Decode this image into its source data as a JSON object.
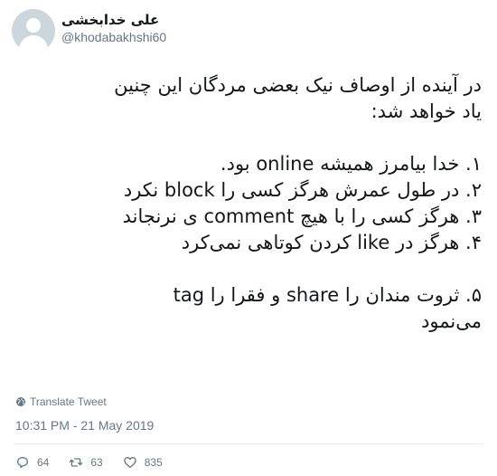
{
  "author": {
    "display_name": "علی خدابخشی",
    "handle": "@khodabakhshi60"
  },
  "tweet": {
    "lines": [
      "در آینده از اوصاف نیک بعضی مردگان این چنین",
      "یاد خواهد شد:",
      "",
      "۱. خدا بیامرز همیشه online بود.",
      "۲. در طول عمرش هرگز کسی را block نکرد",
      "۳. هرگز کسی را با هیچ comment ی نرنجاند",
      "۴. هرگز در like کردن کوتاهی نمی‌کرد",
      "",
      "۵. ثروت مندان را share و فقرا را tag",
      "می‌نمود"
    ]
  },
  "translate_label": "Translate Tweet",
  "timestamp": "10:31 PM - 21 May 2019",
  "actions": {
    "replies": "64",
    "retweets": "63",
    "likes": "835"
  },
  "icons": {
    "translate": "globe-icon",
    "reply": "reply-icon",
    "retweet": "retweet-icon",
    "like": "heart-icon"
  },
  "colors": {
    "secondary_text": "#657786",
    "divider": "#e6ecf0",
    "avatar_bg": "#ccd6dd"
  }
}
